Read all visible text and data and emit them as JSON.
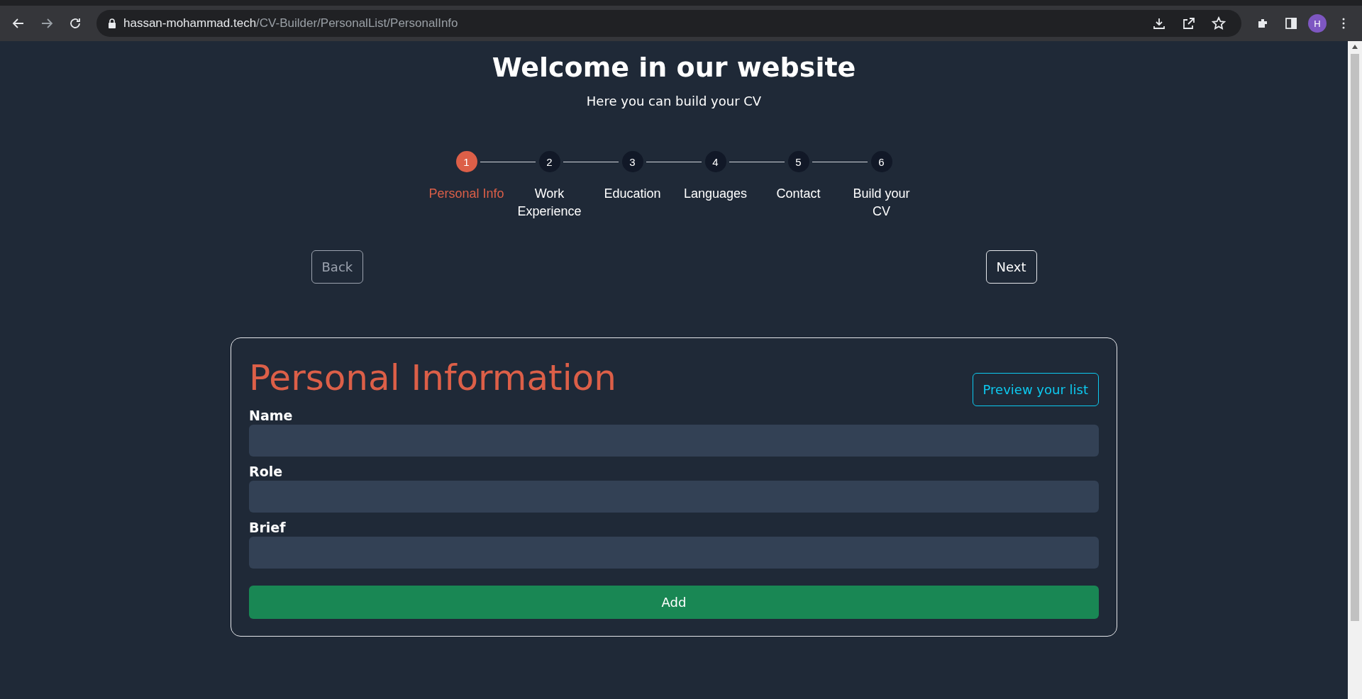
{
  "browser": {
    "url_host": "hassan-mohammad.tech",
    "url_path": "/CV-Builder/PersonalList/PersonalInfo",
    "profile_initial": "H"
  },
  "header": {
    "title": "Welcome in our website",
    "subtitle": "Here you can build your CV"
  },
  "steps": [
    {
      "number": "1",
      "label": "Personal Info",
      "selected": true
    },
    {
      "number": "2",
      "label": "Work Experience",
      "selected": false
    },
    {
      "number": "3",
      "label": "Education",
      "selected": false
    },
    {
      "number": "4",
      "label": "Languages",
      "selected": false
    },
    {
      "number": "5",
      "label": "Contact",
      "selected": false
    },
    {
      "number": "6",
      "label": "Build your CV",
      "selected": false
    }
  ],
  "nav": {
    "back": {
      "label": "Back",
      "disabled": true
    },
    "next": {
      "label": "Next",
      "disabled": false
    }
  },
  "card": {
    "title": "Personal Information",
    "preview_button": "Preview your list",
    "fields": [
      {
        "label": "Name"
      },
      {
        "label": "Role"
      },
      {
        "label": "Brief"
      }
    ],
    "submit": "Add"
  }
}
